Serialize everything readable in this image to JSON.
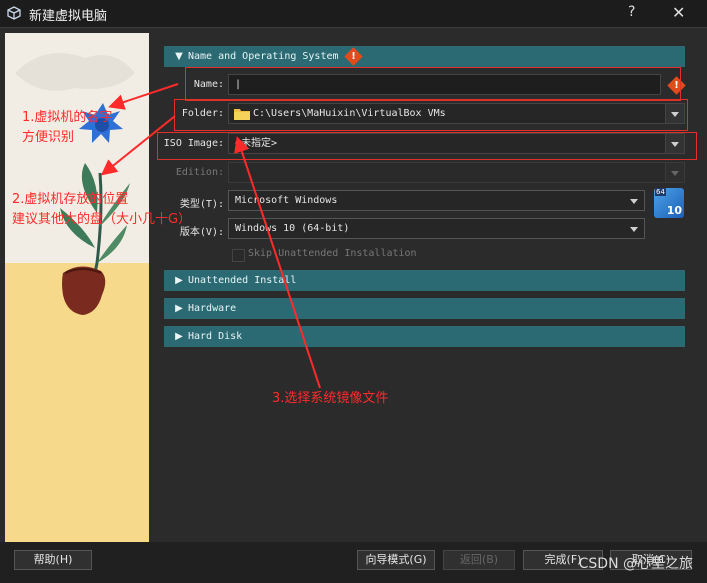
{
  "window": {
    "title": "新建虚拟电脑",
    "help_label": "?",
    "close_label": "✕"
  },
  "sections": {
    "name_os": {
      "label": "Name and Operating System"
    },
    "unattended": {
      "label": "Unattended Install"
    },
    "hardware": {
      "label": "Hardware"
    },
    "hard_disk": {
      "label": "Hard Disk"
    }
  },
  "form": {
    "name_label": "Name:",
    "name_value": "|",
    "folder_label": "Folder:",
    "folder_value": "C:\\Users\\MaHuixin\\VirtualBox VMs",
    "iso_label": "ISO Image:",
    "iso_value": "<未指定>",
    "edition_label": "Edition:",
    "type_label": "类型(T):",
    "type_value": "Microsoft Windows",
    "version_label": "版本(V):",
    "version_value": "Windows 10 (64-bit)",
    "skip_label": "Skip Unattended Installation",
    "os_badge": "10",
    "os_badge_top": "64"
  },
  "annotations": {
    "note1_line1": "1.虚拟机的名字",
    "note1_line2": "方便识别",
    "note2_line1": "2.虚拟机存放的位置",
    "note2_line2": "建议其他大的盘（大小几十G）",
    "note3": "3.选择系统镜像文件"
  },
  "buttons": {
    "help": "帮助(H)",
    "guided": "向导模式(G)",
    "back": "返回(B)",
    "finish": "完成(F)",
    "cancel": "取消(C)"
  },
  "watermark": "CSDN @心里之旅",
  "colors": {
    "section": "#2b6a73",
    "annotation": "#ff2a2a",
    "warning": "#e24c1d"
  }
}
